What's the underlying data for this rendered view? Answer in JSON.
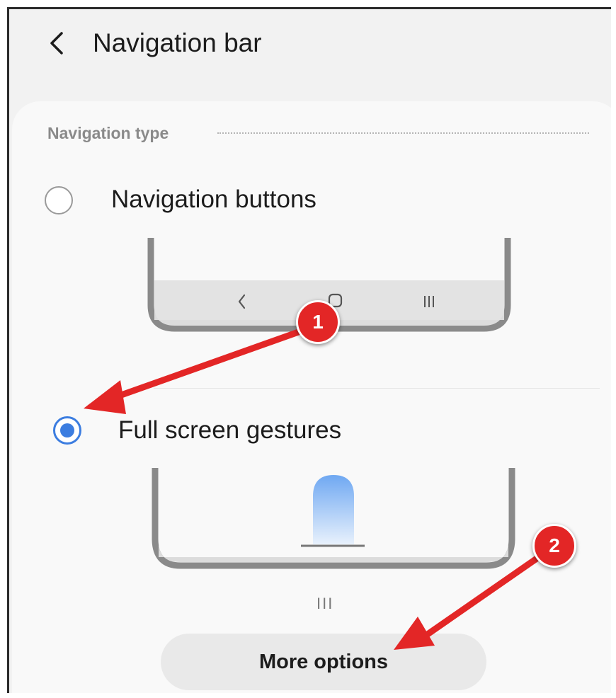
{
  "header": {
    "back_icon": "chevron-left-icon",
    "title": "Navigation bar"
  },
  "navigation_type": {
    "section_label": "Navigation type",
    "options": [
      {
        "label": "Navigation buttons",
        "selected": false
      },
      {
        "label": "Full screen gestures",
        "selected": true
      }
    ],
    "buttons_preview": {
      "icons": [
        "back-chevron-icon",
        "home-icon",
        "recents-icon"
      ]
    },
    "gesture_preview": {
      "handle_glyph": "III"
    }
  },
  "more_options_label": "More options",
  "annotations": {
    "marker_1": "1",
    "marker_2": "2",
    "color": "#e32626"
  },
  "colors": {
    "accent": "#3c7de0",
    "frame_background": "#f2f2f2",
    "card_background": "#f9f9f9",
    "button_background": "#e9e9e9"
  }
}
